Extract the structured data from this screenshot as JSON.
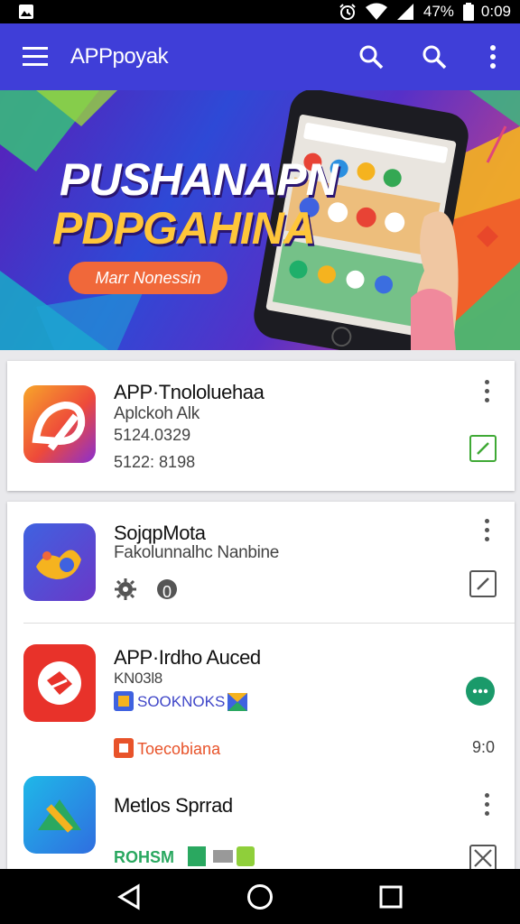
{
  "status_bar": {
    "battery": "47%",
    "time": "0:09",
    "icons": [
      "image-icon",
      "alarm-icon",
      "wifi-icon",
      "signal-icon",
      "battery-icon"
    ]
  },
  "app_bar": {
    "title": "APPpoyak",
    "icons": [
      "menu-icon",
      "search-icon",
      "search-icon",
      "more-vert-icon"
    ],
    "color": "#3f3ed8"
  },
  "banner": {
    "headline_1": "PUSHANAPN",
    "headline_2": "PDPGAHINA",
    "cta_label": "Marr Nonessin"
  },
  "cards": [
    {
      "items": [
        {
          "name": "APP·Tnololuehaa",
          "subtitle": "Aplckoh Alk",
          "meta_1": "5124.0329",
          "meta_2": "5122: 8198",
          "action_icon": "edit-square-icon",
          "action_color": "#3fa935"
        }
      ]
    },
    {
      "items": [
        {
          "name": "SojqpMota",
          "subtitle": "Fakolunnalhc Nanbine",
          "meta_1": "0 枝",
          "action_icon": "edit-square-icon"
        },
        {
          "name": "APP·Irdho Auced",
          "subtitle": "KN03l8",
          "tag": "SOOKNOKS",
          "bottom_tag": "Toecobiana",
          "right_value": "9:0",
          "action_icon": "more-horiz-icon",
          "action_color": "#1a9a6a"
        },
        {
          "name": "Metlos Sprrad",
          "tag": "ROHSM",
          "action_icon": "close-square-icon"
        }
      ]
    }
  ],
  "nav_bar": {
    "icons": [
      "back-icon",
      "home-icon",
      "recents-icon"
    ]
  }
}
